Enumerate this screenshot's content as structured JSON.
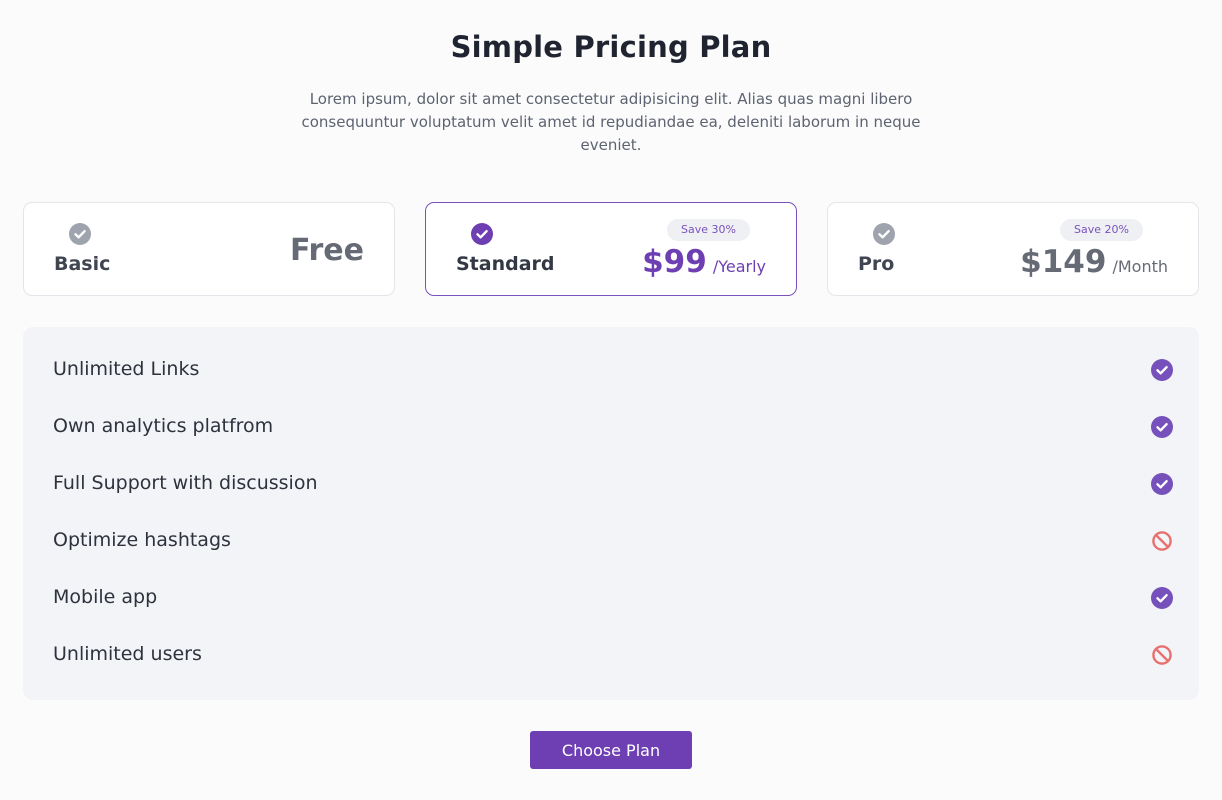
{
  "header": {
    "title": "Simple Pricing Plan",
    "subtitle": "Lorem ipsum, dolor sit amet consectetur adipisicing elit. Alias quas magni libero consequuntur voluptatum velit amet id repudiandae ea, deleniti laborum in neque eveniet."
  },
  "plans": [
    {
      "name": "Basic",
      "price": "Free",
      "period": "",
      "badge": "",
      "selected": false,
      "icon": "check-circle-icon"
    },
    {
      "name": "Standard",
      "price": "$99",
      "period": "/Yearly",
      "badge": "Save 30%",
      "selected": true,
      "icon": "check-circle-icon"
    },
    {
      "name": "Pro",
      "price": "$149",
      "period": "/Month",
      "badge": "Save 20%",
      "selected": false,
      "icon": "check-circle-icon"
    }
  ],
  "features": [
    {
      "label": "Unlimited Links",
      "included": true,
      "icon": "check-circle-icon"
    },
    {
      "label": "Own analytics platfrom",
      "included": true,
      "icon": "check-circle-icon"
    },
    {
      "label": "Full Support with discussion",
      "included": true,
      "icon": "check-circle-icon"
    },
    {
      "label": "Optimize hashtags",
      "included": false,
      "icon": "ban-icon"
    },
    {
      "label": "Mobile app",
      "included": true,
      "icon": "check-circle-icon"
    },
    {
      "label": "Unlimited users",
      "included": false,
      "icon": "ban-icon"
    }
  ],
  "cta": {
    "label": "Choose Plan"
  },
  "colors": {
    "accent": "#6d3fb2",
    "muted_check": "#9ea3ad",
    "excluded": "#e8716f",
    "feature_panel": "#f3f4f7"
  }
}
